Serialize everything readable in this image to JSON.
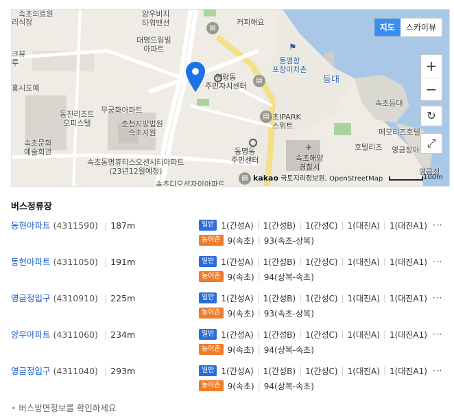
{
  "map": {
    "type_map": "지도",
    "type_skyview": "스카이뷰",
    "zoom_in": "+",
    "zoom_out": "−",
    "refresh_icon": "↻",
    "fullscreen_icon": "⤢",
    "attribution_brand": "kakao",
    "attribution_text": "국토지리정보원, OpenStreetMap",
    "scale": "100m",
    "labels": [
      "속초의료원",
      "리식장",
      "양우비치\n타워맨션",
      "커피해요",
      "대명드림빌\n아파트",
      "동명항\n포장마차촌",
      "크뷰\n루",
      "영랑동\n주민자치센터",
      "홍시도예",
      "동진리조트\n오피스텔",
      "무궁화아파트",
      "춘천지방법원\n속초지원",
      "초IPARK\n스위트",
      "속초등대",
      "메모리즈호텔",
      "속초문화\n예술회관",
      "동명동\n주민센터",
      "속초해양\n경찰서",
      "호텔리츠",
      "영금정아",
      "속초동명휴티스오션시티아파트\n(23년12월예정)",
      "속초디오션자이아파트",
      "영금정",
      "등대"
    ]
  },
  "section_title": "버스정류장",
  "stops": [
    {
      "name": "동현아파트",
      "id": "(4311590)",
      "distance": "187m",
      "general_badge": "일반",
      "general_routes": [
        "1(간성A)",
        "1(간성B)",
        "1(간성C)",
        "1(대진A)",
        "1(대진A1)"
      ],
      "rural_badge": "농어촌",
      "rural_routes": [
        "9(속초)",
        "93(속초-상복)"
      ],
      "more": "···"
    },
    {
      "name": "동현아파트",
      "id": "(4311050)",
      "distance": "191m",
      "general_badge": "일반",
      "general_routes": [
        "1(간성A)",
        "1(간성B)",
        "1(간성C)",
        "1(대진A)",
        "1(대진A1)"
      ],
      "rural_badge": "농어촌",
      "rural_routes": [
        "9(속초)",
        "94(상복-속초)"
      ],
      "more": "···"
    },
    {
      "name": "영금정입구",
      "id": "(4310910)",
      "distance": "225m",
      "general_badge": "일반",
      "general_routes": [
        "1(간성A)",
        "1(간성B)",
        "1(간성C)",
        "1(대진A)",
        "1(대진A1)"
      ],
      "rural_badge": "농어촌",
      "rural_routes": [
        "9(속초)",
        "93(속초-상복)"
      ],
      "more": "···"
    },
    {
      "name": "양우아파트",
      "id": "(4311060)",
      "distance": "234m",
      "general_badge": "일반",
      "general_routes": [
        "1(간성A)",
        "1(간성B)",
        "1(간성C)",
        "1(대진A)",
        "1(대진A1)"
      ],
      "rural_badge": "농어촌",
      "rural_routes": [
        "9(속초)",
        "94(상복-속초)"
      ],
      "more": "···"
    },
    {
      "name": "영금정입구",
      "id": "(4311040)",
      "distance": "293m",
      "general_badge": "일반",
      "general_routes": [
        "1(간성A)",
        "1(간성B)",
        "1(간성C)",
        "1(대진A)",
        "1(대진A1)"
      ],
      "rural_badge": "농어촌",
      "rural_routes": [
        "9(속초)",
        "94(상복-속초)"
      ],
      "more": "···"
    }
  ],
  "footer_note": "버스방면정보를 확인하세요",
  "colors": {
    "accent": "#3a8ef0",
    "link": "#1a5fd0",
    "general": "#2c6fd6",
    "rural": "#f07c2a",
    "sea": "#a9c8e8",
    "road": "#f3e08a"
  }
}
